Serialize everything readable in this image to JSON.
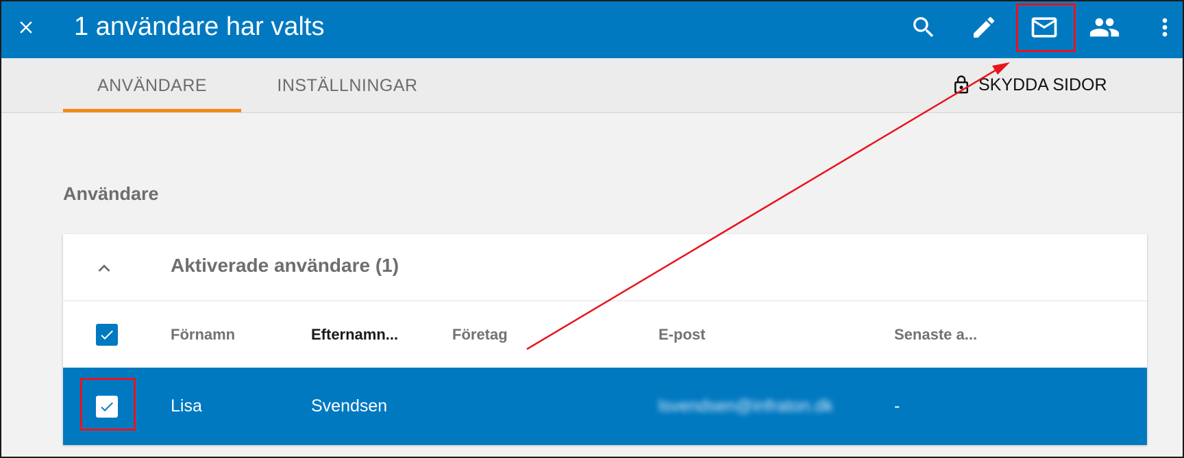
{
  "appbar": {
    "title": "1 användare har valts",
    "tools": [
      {
        "name": "search",
        "icon": "search-icon"
      },
      {
        "name": "edit",
        "icon": "pencil-icon"
      },
      {
        "name": "mail",
        "icon": "mail-icon"
      },
      {
        "name": "groups",
        "icon": "people-icon"
      },
      {
        "name": "more",
        "icon": "more-vertical-icon"
      }
    ],
    "background": "#0079c1"
  },
  "tabs": [
    {
      "label": "ANVÄNDARE",
      "active": true
    },
    {
      "label": "INSTÄLLNINGAR",
      "active": false
    }
  ],
  "protect_button": {
    "label": "SKYDDA SIDOR",
    "icon": "lock-icon"
  },
  "section": {
    "title": "Användare"
  },
  "group": {
    "title": "Aktiverade användare (1)",
    "expanded": true
  },
  "table": {
    "columns": [
      "Förnamn",
      "Efternamn...",
      "Företag",
      "E-post",
      "Senaste a..."
    ],
    "sorted_column": "Efternamn...",
    "rows": [
      {
        "selected": true,
        "first_name": "Lisa",
        "last_name": "Svendsen",
        "company": "",
        "email": "lsvendsen@infraton.dk",
        "last": "-"
      }
    ]
  },
  "colors": {
    "accent": "#0079c1",
    "tab_indicator": "#f08a1c",
    "annotation": "#e8141c"
  }
}
